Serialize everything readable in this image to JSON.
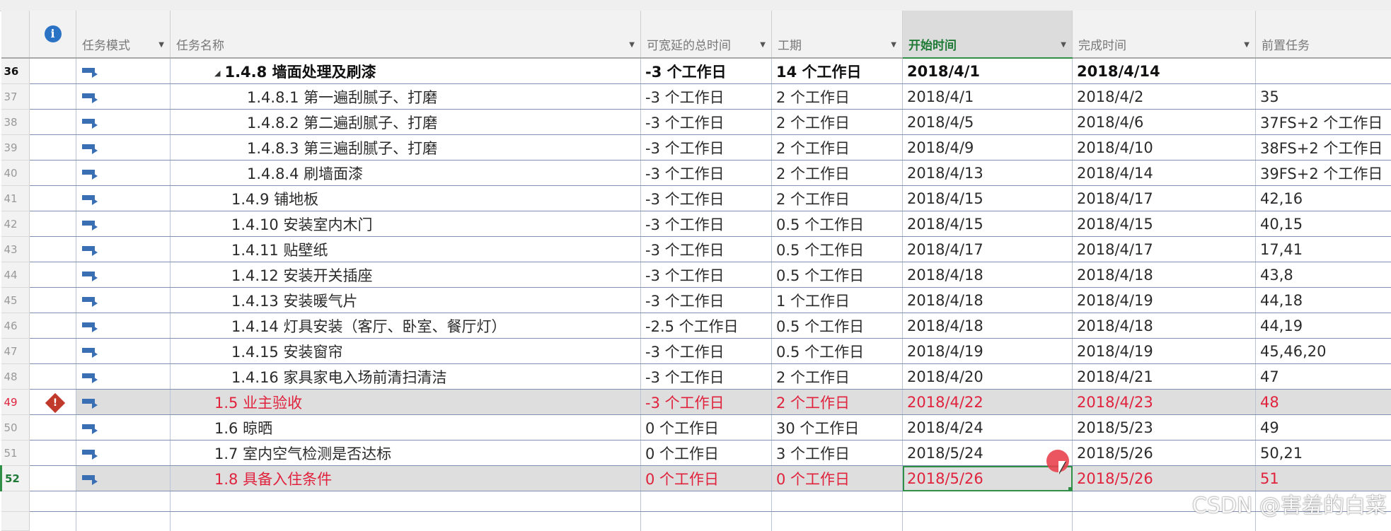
{
  "columns": {
    "info": "i",
    "mode": "任务模式",
    "name": "任务名称",
    "slack": "可宽延的总时间",
    "duration": "工期",
    "start": "开始时间",
    "finish": "完成时间",
    "predecessors": "前置任务"
  },
  "rows": [
    {
      "rn": "36",
      "name": "1.4.8 墙面处理及刷漆",
      "slack": "-3 个工作日",
      "duration": "14 个工作日",
      "start": "2018/4/1",
      "finish": "2018/4/14",
      "pred": ""
    },
    {
      "rn": "37",
      "name": "1.4.8.1 第一遍刮腻子、打磨",
      "slack": "-3 个工作日",
      "duration": "2 个工作日",
      "start": "2018/4/1",
      "finish": "2018/4/2",
      "pred": "35"
    },
    {
      "rn": "38",
      "name": "1.4.8.2 第二遍刮腻子、打磨",
      "slack": "-3 个工作日",
      "duration": "2 个工作日",
      "start": "2018/4/5",
      "finish": "2018/4/6",
      "pred": "37FS+2 个工作日"
    },
    {
      "rn": "39",
      "name": "1.4.8.3 第三遍刮腻子、打磨",
      "slack": "-3 个工作日",
      "duration": "2 个工作日",
      "start": "2018/4/9",
      "finish": "2018/4/10",
      "pred": "38FS+2 个工作日"
    },
    {
      "rn": "40",
      "name": "1.4.8.4 刷墙面漆",
      "slack": "-3 个工作日",
      "duration": "2 个工作日",
      "start": "2018/4/13",
      "finish": "2018/4/14",
      "pred": "39FS+2 个工作日"
    },
    {
      "rn": "41",
      "name": "1.4.9 铺地板",
      "slack": "-3 个工作日",
      "duration": "2 个工作日",
      "start": "2018/4/15",
      "finish": "2018/4/17",
      "pred": "42,16"
    },
    {
      "rn": "42",
      "name": "1.4.10 安装室内木门",
      "slack": "-3 个工作日",
      "duration": "0.5 个工作日",
      "start": "2018/4/15",
      "finish": "2018/4/15",
      "pred": "40,15"
    },
    {
      "rn": "43",
      "name": "1.4.11 贴壁纸",
      "slack": "-3 个工作日",
      "duration": "0.5 个工作日",
      "start": "2018/4/17",
      "finish": "2018/4/17",
      "pred": "17,41"
    },
    {
      "rn": "44",
      "name": "1.4.12 安装开关插座",
      "slack": "-3 个工作日",
      "duration": "0.5 个工作日",
      "start": "2018/4/18",
      "finish": "2018/4/18",
      "pred": "43,8"
    },
    {
      "rn": "45",
      "name": "1.4.13 安装暖气片",
      "slack": "-3 个工作日",
      "duration": "1 个工作日",
      "start": "2018/4/18",
      "finish": "2018/4/19",
      "pred": "44,18"
    },
    {
      "rn": "46",
      "name": "1.4.14 灯具安装（客厅、卧室、餐厅灯）",
      "slack": "-2.5 个工作日",
      "duration": "0.5 个工作日",
      "start": "2018/4/18",
      "finish": "2018/4/18",
      "pred": "44,19"
    },
    {
      "rn": "47",
      "name": "1.4.15 安装窗帘",
      "slack": "-3 个工作日",
      "duration": "0.5 个工作日",
      "start": "2018/4/19",
      "finish": "2018/4/19",
      "pred": "45,46,20"
    },
    {
      "rn": "48",
      "name": "1.4.16 家具家电入场前清扫清洁",
      "slack": "-3 个工作日",
      "duration": "2 个工作日",
      "start": "2018/4/20",
      "finish": "2018/4/21",
      "pred": "47"
    },
    {
      "rn": "49",
      "name": "1.5 业主验收",
      "slack": "-3 个工作日",
      "duration": "2 个工作日",
      "start": "2018/4/22",
      "finish": "2018/4/23",
      "pred": "48"
    },
    {
      "rn": "50",
      "name": "1.6 晾晒",
      "slack": "0 个工作日",
      "duration": "30 个工作日",
      "start": "2018/4/24",
      "finish": "2018/5/23",
      "pred": "49"
    },
    {
      "rn": "51",
      "name": "1.7 室内空气检测是否达标",
      "slack": "0 个工作日",
      "duration": "3 个工作日",
      "start": "2018/5/24",
      "finish": "2018/5/26",
      "pred": "50,21"
    },
    {
      "rn": "52",
      "name": "1.8 具备入住条件",
      "slack": "0 个工作日",
      "duration": "0 个工作日",
      "start": "2018/5/26",
      "finish": "2018/5/26",
      "pred": "51"
    }
  ],
  "icons": {
    "info": "info-icon",
    "mode": "auto-schedule-icon",
    "warning": "warning-icon"
  },
  "colors": {
    "critical": "#e0223d",
    "active_header": "#1f7a36"
  },
  "watermark": "CSDN @害羞的白菜"
}
